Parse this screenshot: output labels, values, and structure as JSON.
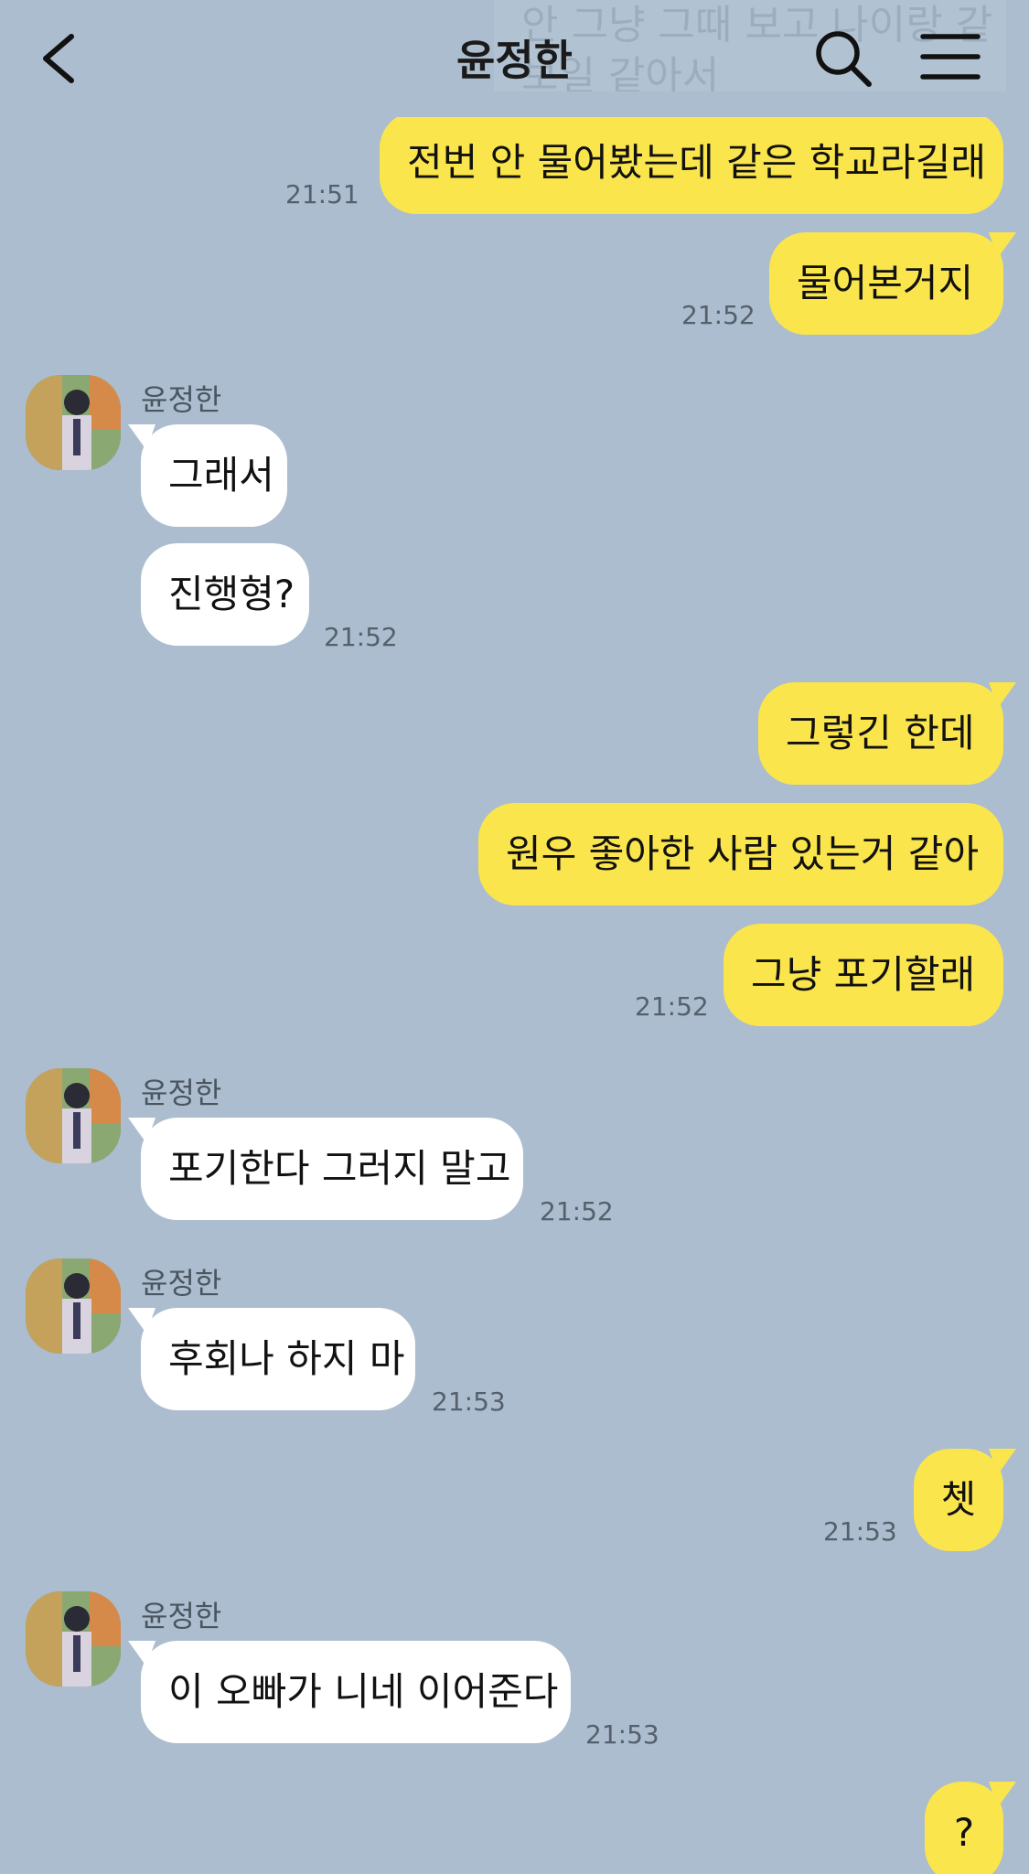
{
  "header": {
    "title": "윤정한",
    "ghost_text_line1": "안 그냥 그때 보고 나이랑 같",
    "ghost_text_line2": "보일 같아서"
  },
  "messages": [
    {
      "id": "m1",
      "from": "me",
      "text": "전번 안 물어봤는데 같은 학교라길래",
      "time": "21:51"
    },
    {
      "id": "m2",
      "from": "me",
      "text": "물어본거지",
      "time": "21:52"
    },
    {
      "id": "m3",
      "from": "them",
      "sender": "윤정한",
      "text": "그래서"
    },
    {
      "id": "m4",
      "from": "them",
      "text": "진행형?",
      "time": "21:52"
    },
    {
      "id": "m5",
      "from": "me",
      "text": "그렇긴 한데"
    },
    {
      "id": "m6",
      "from": "me",
      "text": "원우 좋아한 사람 있는거 같아"
    },
    {
      "id": "m7",
      "from": "me",
      "text": "그냥 포기할래",
      "time": "21:52"
    },
    {
      "id": "m8",
      "from": "them",
      "sender": "윤정한",
      "text": "포기한다 그러지 말고",
      "time": "21:52"
    },
    {
      "id": "m9",
      "from": "them",
      "sender": "윤정한",
      "text": "후회나 하지 마",
      "time": "21:53"
    },
    {
      "id": "m10",
      "from": "me",
      "text": "쳇",
      "time": "21:53"
    },
    {
      "id": "m11",
      "from": "them",
      "sender": "윤정한",
      "text": "이 오빠가 니네 이어준다",
      "time": "21:53"
    },
    {
      "id": "m12",
      "from": "me",
      "text": "?"
    }
  ],
  "colors": {
    "background": "#abbdce",
    "my_bubble": "#fbe54d",
    "their_bubble": "#ffffff"
  },
  "icons": {
    "back": "chevron-left-icon",
    "search": "search-icon",
    "menu": "hamburger-menu-icon"
  }
}
